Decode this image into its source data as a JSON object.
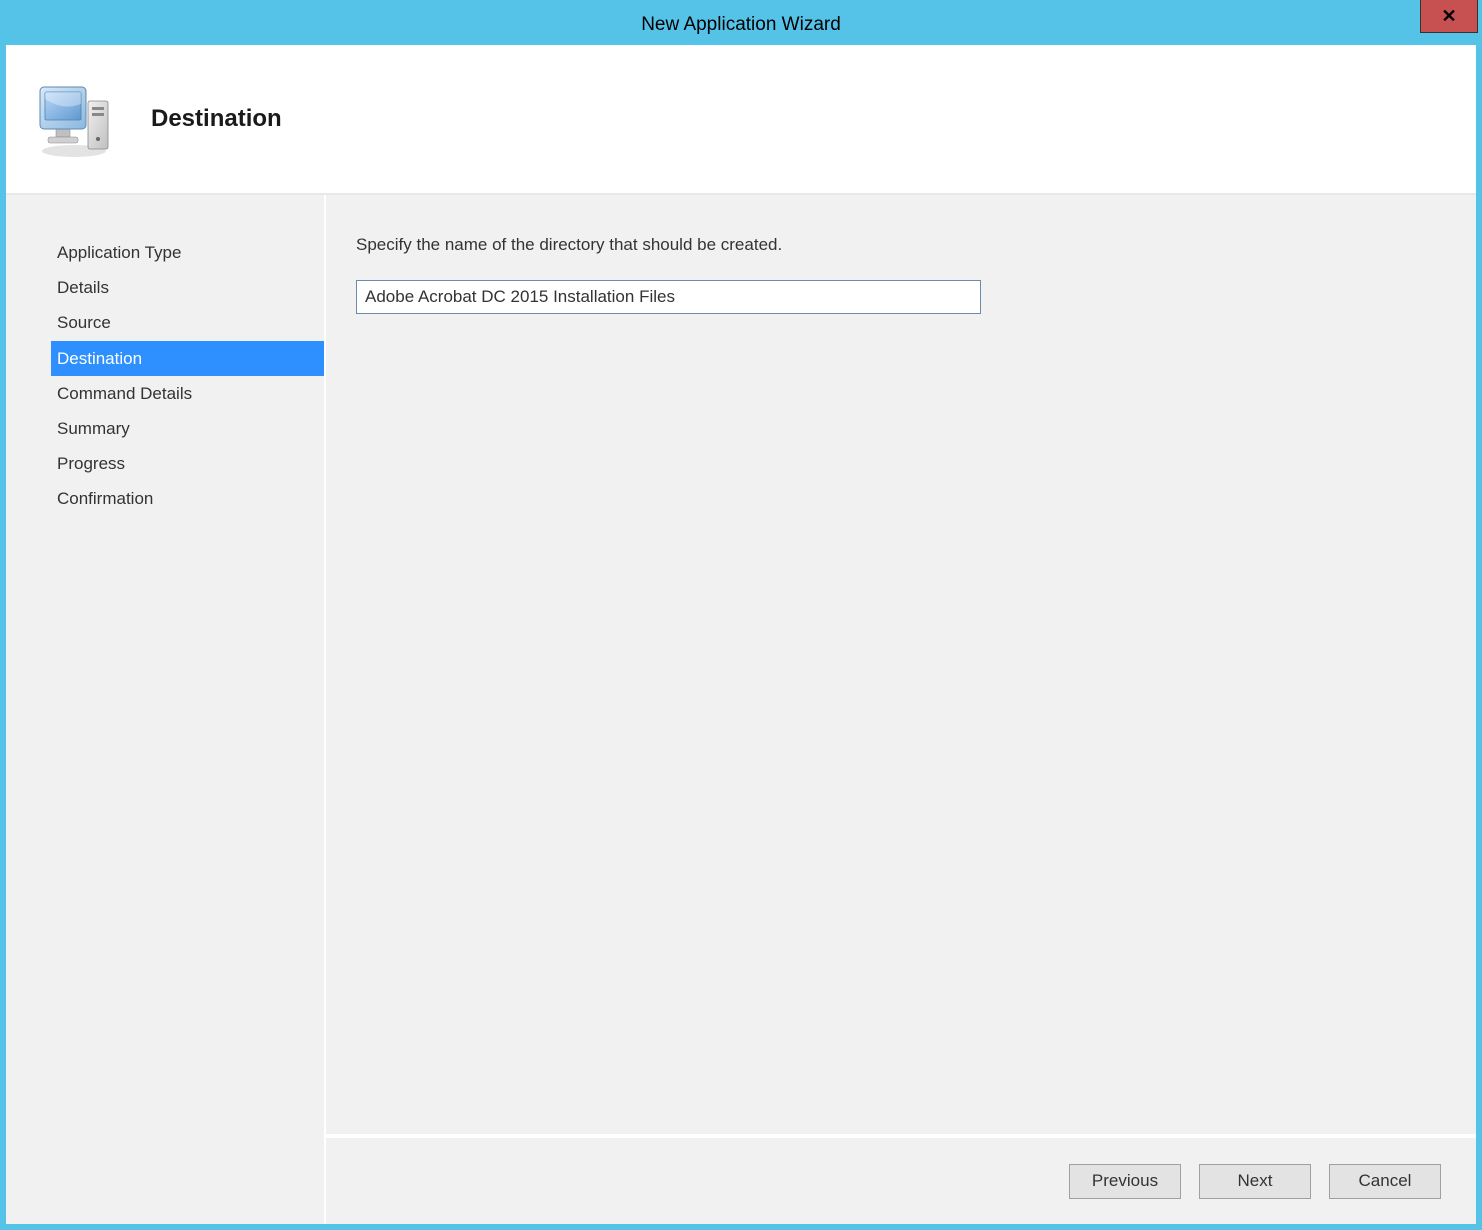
{
  "window": {
    "title": "New Application Wizard"
  },
  "header": {
    "title": "Destination"
  },
  "sidebar": {
    "items": [
      {
        "label": "Application Type",
        "selected": false
      },
      {
        "label": "Details",
        "selected": false
      },
      {
        "label": "Source",
        "selected": false
      },
      {
        "label": "Destination",
        "selected": true
      },
      {
        "label": "Command Details",
        "selected": false
      },
      {
        "label": "Summary",
        "selected": false
      },
      {
        "label": "Progress",
        "selected": false
      },
      {
        "label": "Confirmation",
        "selected": false
      }
    ]
  },
  "main": {
    "instruction": "Specify the name of the directory that should be created.",
    "directory_value": "Adobe Acrobat DC 2015 Installation Files"
  },
  "footer": {
    "previous_label": "Previous",
    "next_label": "Next",
    "cancel_label": "Cancel"
  }
}
